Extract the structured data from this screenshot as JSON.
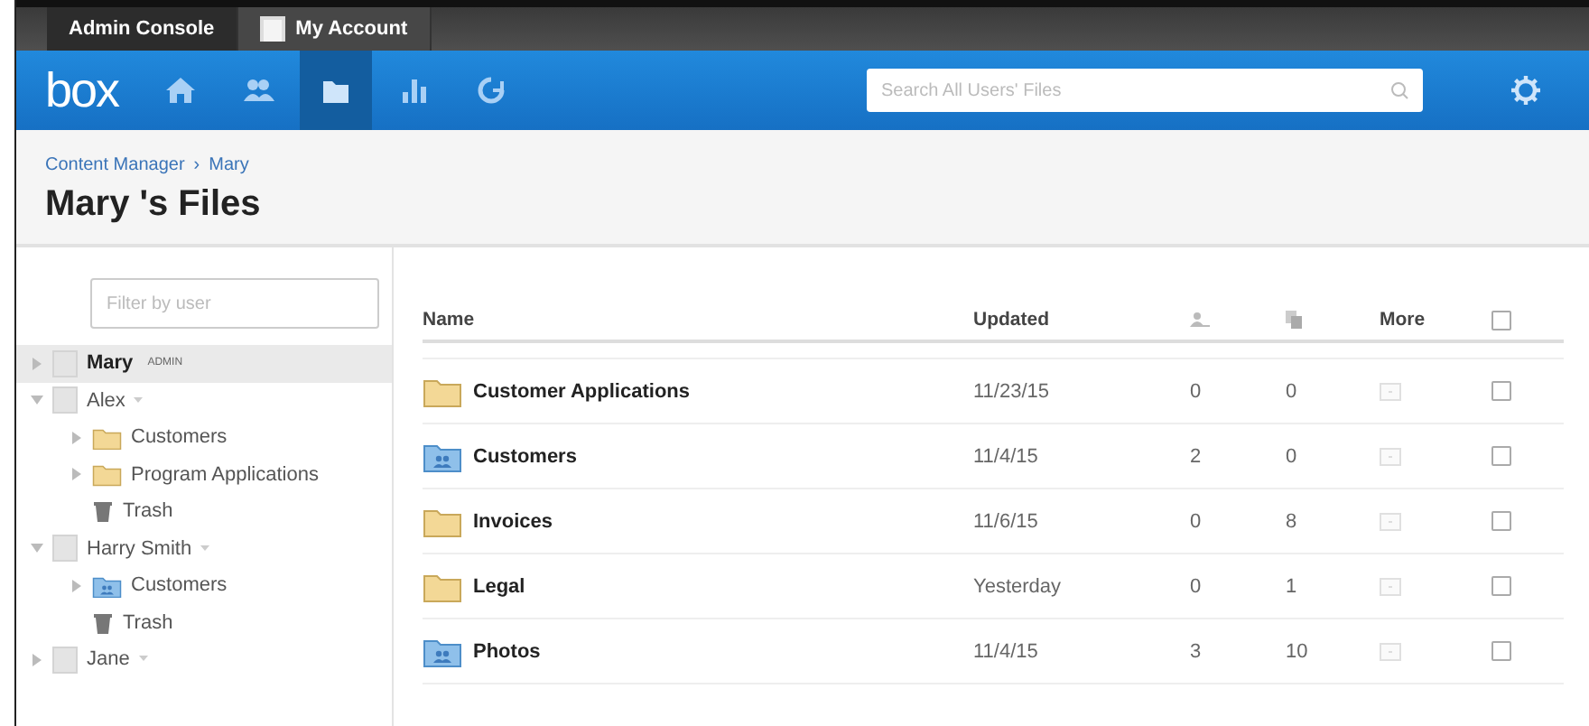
{
  "top_tabs": [
    {
      "label": "Admin Console",
      "kind": "text",
      "selected": true
    },
    {
      "label": "My Account",
      "kind": "avatar",
      "selected": false
    }
  ],
  "nav": {
    "logo": "box",
    "items": [
      {
        "kind": "home",
        "selected": false
      },
      {
        "kind": "users",
        "selected": false
      },
      {
        "kind": "folder",
        "selected": true
      },
      {
        "kind": "reports",
        "selected": false
      },
      {
        "kind": "sync",
        "selected": false
      }
    ],
    "search": {
      "placeholder": "Search All Users' Files"
    }
  },
  "breadcrumb": [
    "Content Manager",
    "›",
    "Mary"
  ],
  "title": "Mary 's Files",
  "sidebar": {
    "filter": {
      "placeholder": "Filter by user"
    },
    "users": [
      {
        "name": "Mary",
        "badge": "ADMIN",
        "expanded": false,
        "selected": true
      },
      {
        "name": "Alex",
        "expanded": true,
        "selected": false,
        "children": [
          {
            "kind": "folder",
            "name": "Customers",
            "expandable": true
          },
          {
            "kind": "folder",
            "name": "Program Applications",
            "expandable": true
          },
          {
            "kind": "trash",
            "name": "Trash",
            "expandable": false
          }
        ]
      },
      {
        "name": "Harry Smith",
        "expanded": true,
        "selected": false,
        "children": [
          {
            "kind": "shared",
            "name": "Customers",
            "expandable": true
          },
          {
            "kind": "trash",
            "name": "Trash",
            "expandable": false
          }
        ]
      },
      {
        "name": "Jane",
        "expanded": false,
        "selected": false
      }
    ]
  },
  "table": {
    "columns": [
      "Name",
      "Updated",
      "More"
    ],
    "all_checked": false,
    "rows": [
      {
        "kind": "folder",
        "name": "Customer Applications",
        "updated": "11/23/15",
        "collaborators": "0",
        "files": "0",
        "checked": false
      },
      {
        "kind": "shared",
        "name": "Customers",
        "updated": "11/4/15",
        "collaborators": "2",
        "files": "0",
        "checked": false
      },
      {
        "kind": "folder",
        "name": "Invoices",
        "updated": "11/6/15",
        "collaborators": "0",
        "files": "8",
        "checked": false
      },
      {
        "kind": "folder",
        "name": "Legal",
        "updated": "Yesterday",
        "collaborators": "0",
        "files": "1",
        "checked": false
      },
      {
        "kind": "shared",
        "name": "Photos",
        "updated": "11/4/15",
        "collaborators": "3",
        "files": "10",
        "checked": false
      }
    ]
  }
}
